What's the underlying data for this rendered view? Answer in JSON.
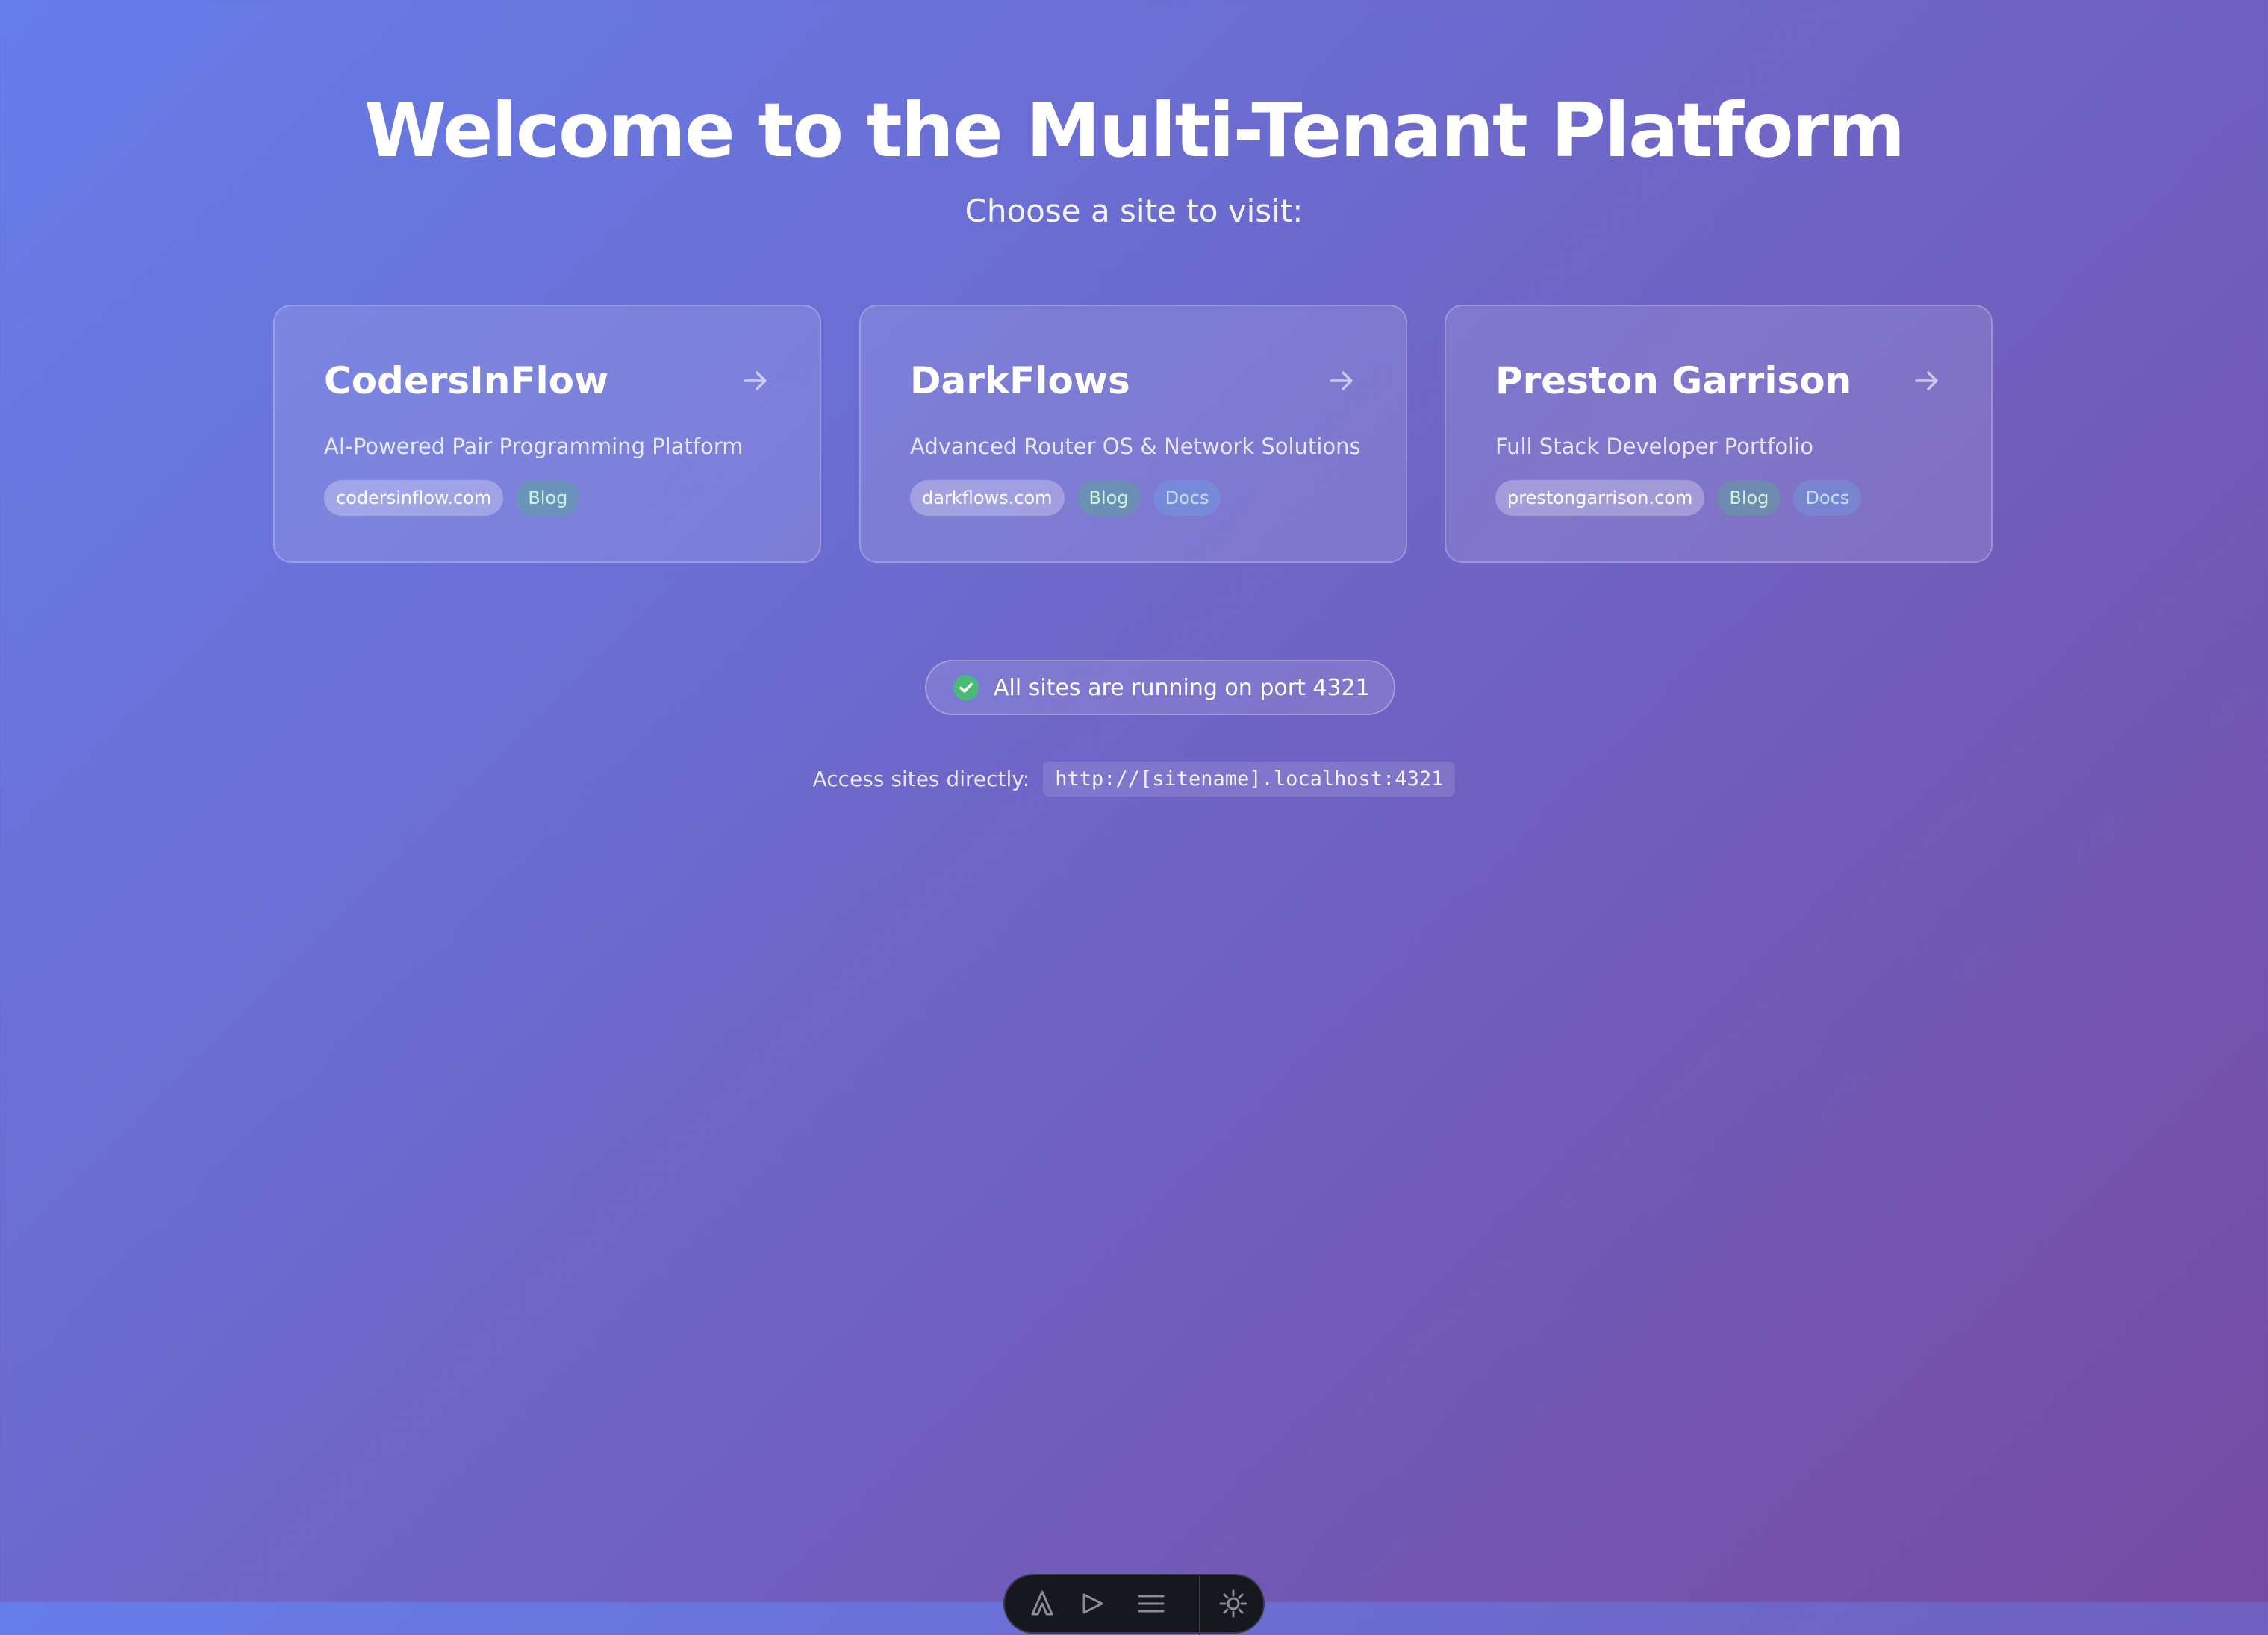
{
  "header": {
    "title": "Welcome to the Multi-Tenant Platform",
    "subtitle": "Choose a site to visit:"
  },
  "sites": [
    {
      "name": "CodersInFlow",
      "description": "AI-Powered Pair Programming Platform",
      "domain": "codersinflow.com",
      "tags": [
        "Blog"
      ]
    },
    {
      "name": "DarkFlows",
      "description": "Advanced Router OS & Network Solutions",
      "domain": "darkflows.com",
      "tags": [
        "Blog",
        "Docs"
      ]
    },
    {
      "name": "Preston Garrison",
      "description": "Full Stack Developer Portfolio",
      "domain": "prestongarrison.com",
      "tags": [
        "Blog",
        "Docs"
      ]
    }
  ],
  "status": {
    "text": "All sites are running on port 4321",
    "icon": "check-circle-icon",
    "color": "#48bb78"
  },
  "access": {
    "label": "Access sites directly:",
    "url_pattern": "http://[sitename].localhost:4321"
  },
  "toolbar": {
    "icons": [
      "astro-logo-icon",
      "audit-icon",
      "menu-icon",
      "settings-icon"
    ]
  },
  "colors": {
    "gradient_start": "#667eea",
    "gradient_end": "#764ba2"
  }
}
